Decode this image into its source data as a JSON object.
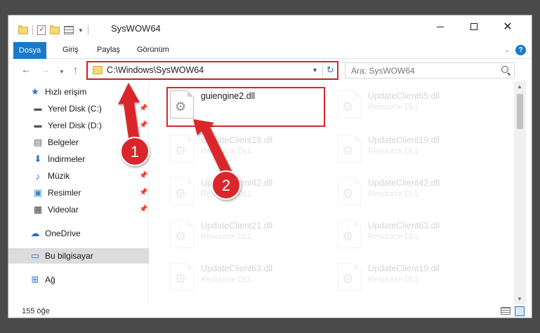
{
  "window": {
    "title": "SysWOW64"
  },
  "ribbon": {
    "tabs": [
      "Dosya",
      "Giriş",
      "Paylaş",
      "Görünüm"
    ],
    "help_icon": "?"
  },
  "navbar": {
    "address": "C:\\Windows\\SysWOW64",
    "search_placeholder": "Ara: SysWOW64"
  },
  "sidebar": {
    "items": [
      {
        "label": "Hızlı erişim",
        "icon": "star-icon"
      },
      {
        "label": "Yerel Disk (C:)",
        "icon": "drive-icon"
      },
      {
        "label": "Yerel Disk (D:)",
        "icon": "drive-icon"
      },
      {
        "label": "Belgeler",
        "icon": "documents-icon"
      },
      {
        "label": "İndirmeler",
        "icon": "download-icon"
      },
      {
        "label": "Müzik",
        "icon": "music-icon"
      },
      {
        "label": "Resimler",
        "icon": "pictures-icon"
      },
      {
        "label": "Videolar",
        "icon": "videos-icon"
      },
      {
        "label": "OneDrive",
        "icon": "cloud-icon"
      },
      {
        "label": "Bu bilgisayar",
        "icon": "computer-icon"
      },
      {
        "label": "Ağ",
        "icon": "network-icon"
      }
    ]
  },
  "files": {
    "left": [
      {
        "name": "guiengine2.dll",
        "type": ""
      },
      {
        "name": "UpdateClient19.dll",
        "type": "Resource DLL"
      },
      {
        "name": "UpdateClient42.dll",
        "type": "Resource DLL"
      },
      {
        "name": "UpdateClient21.dll",
        "type": "Resource DLL"
      },
      {
        "name": "UpdateClient63.dll",
        "type": "Resource DLL"
      }
    ],
    "right": [
      {
        "name": "UpdateClient65.dll",
        "type": "Resource DLL"
      },
      {
        "name": "UpdateClient19.dll",
        "type": "Resource DLL"
      },
      {
        "name": "UpdateClient42.dll",
        "type": "Resource DLL"
      },
      {
        "name": "UpdateClient63.dll",
        "type": "Resource DLL"
      },
      {
        "name": "UpdateClient19.dll",
        "type": "Resource DLL"
      }
    ]
  },
  "status": {
    "count": "155 öğe"
  },
  "annotations": {
    "step1": "1",
    "step2": "2",
    "color": "#d9252a"
  },
  "colors": {
    "accent": "#1979ca",
    "highlight": "#d9252a"
  }
}
